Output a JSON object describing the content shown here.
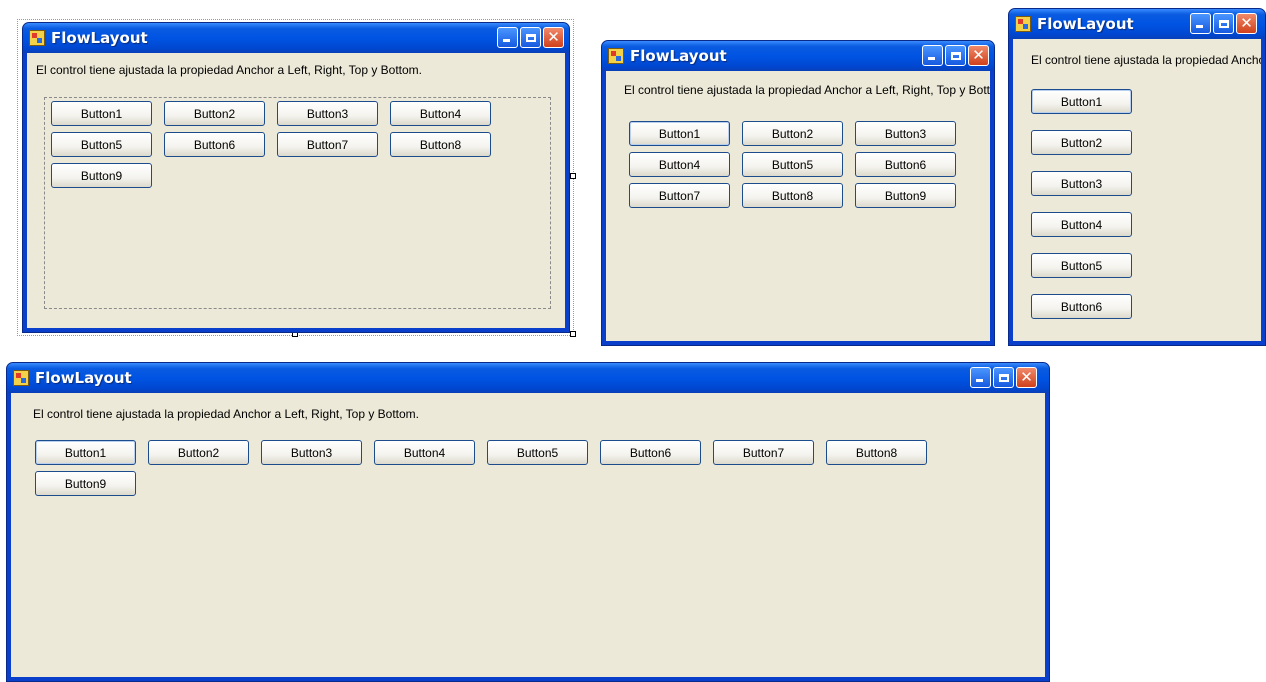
{
  "window_title": "FlowLayout",
  "label_text": "El control tiene ajustada la propiedad Anchor a Left, Right, Top y Bottom.",
  "buttons": [
    "Button1",
    "Button2",
    "Button3",
    "Button4",
    "Button5",
    "Button6",
    "Button7",
    "Button8",
    "Button9"
  ],
  "title_buttons": {
    "minimize": "minimize",
    "maximize": "maximize",
    "close": "close"
  }
}
